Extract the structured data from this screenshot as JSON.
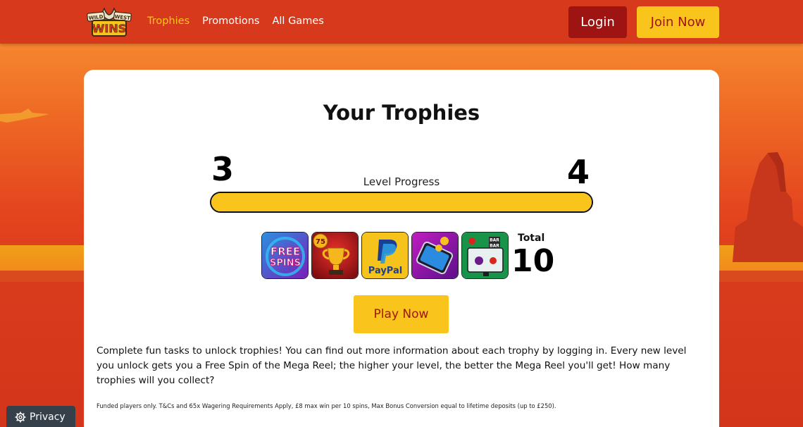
{
  "header": {
    "logo": {
      "line1": "WILD WEST",
      "line2": "WINS"
    },
    "nav": [
      {
        "label": "Trophies",
        "active": true
      },
      {
        "label": "Promotions",
        "active": false
      },
      {
        "label": "All Games",
        "active": false
      }
    ],
    "login_label": "Login",
    "join_label": "Join Now"
  },
  "card": {
    "title": "Your Trophies",
    "level_current": "3",
    "level_next": "4",
    "level_label": "Level Progress",
    "level_progress_fraction": 1.0,
    "trophies": [
      {
        "name": "free-spins",
        "text": "FREE SPINS"
      },
      {
        "name": "trophy-75",
        "text": "75"
      },
      {
        "name": "paypal",
        "text": "PayPal"
      },
      {
        "name": "mobile",
        "text": ""
      },
      {
        "name": "slots",
        "text": "BAR"
      }
    ],
    "total_label": "Total",
    "total_value": "10",
    "play_label": "Play Now",
    "description": "Complete fun tasks to unlock trophies! You can find out more information about each trophy by logging in. Every new level you unlock gets you a Free Spin of the Mega Reel; the higher your level, the better the Mega Reel you'll get! How many trophies will you collect?",
    "terms": "Funded players only. T&Cs and 65x Wagering Requirements Apply, £8 max win per 10 spins, Max Bonus Conversion equal to lifetime deposits (up to £250)."
  },
  "privacy_label": "Privacy",
  "colors": {
    "accent_yellow": "#f9c51d",
    "header_red": "#d7391d",
    "login_red": "#9d1412",
    "privacy_bg": "#36404b"
  }
}
